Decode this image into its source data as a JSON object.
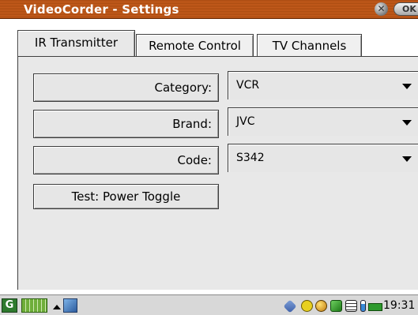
{
  "window": {
    "title": "VideoCorder - Settings",
    "close_glyph": "✕",
    "ok_label": "OK"
  },
  "tabs": [
    {
      "label": "IR Transmitter",
      "active": true
    },
    {
      "label": "Remote Control",
      "active": false
    },
    {
      "label": "TV Channels",
      "active": false
    }
  ],
  "fields": [
    {
      "label": "Category:",
      "value": "VCR"
    },
    {
      "label": "Brand:",
      "value": "JVC"
    },
    {
      "label": "Code:",
      "value": "S342"
    }
  ],
  "test_button": "Test: Power Toggle",
  "taskbar": {
    "start_glyph": "G",
    "tray_icons": [
      "network-icon",
      "pen-icon",
      "globe-icon",
      "cube-icon",
      "notes-icon",
      "battery-icon",
      "connection-icon"
    ],
    "clock": "19:31"
  }
}
